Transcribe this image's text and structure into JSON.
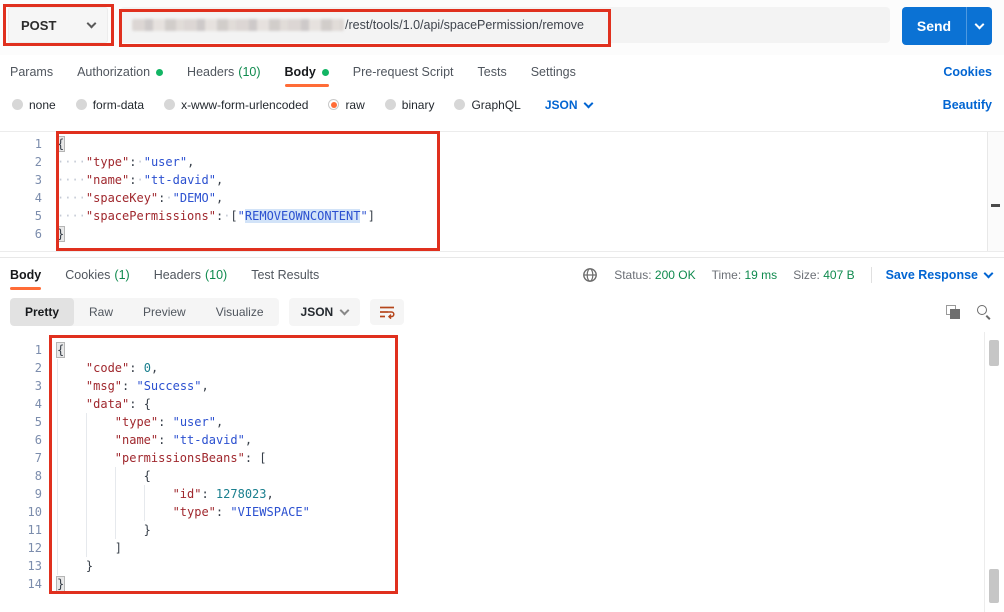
{
  "request": {
    "method": "POST",
    "url_visible": "/rest/tools/1.0/api/spacePermission/remove",
    "send_label": "Send",
    "cookies_link": "Cookies",
    "beautify_link": "Beautify",
    "tabs": [
      {
        "label": "Params"
      },
      {
        "label": "Authorization",
        "dot": true
      },
      {
        "label": "Headers",
        "count": "(10)"
      },
      {
        "label": "Body",
        "dot": true,
        "active": true
      },
      {
        "label": "Pre-request Script"
      },
      {
        "label": "Tests"
      },
      {
        "label": "Settings"
      }
    ],
    "body_modes": [
      {
        "label": "none"
      },
      {
        "label": "form-data"
      },
      {
        "label": "x-www-form-urlencoded"
      },
      {
        "label": "raw",
        "selected": true
      },
      {
        "label": "binary"
      },
      {
        "label": "GraphQL"
      }
    ],
    "language": "JSON",
    "editor_lines": [
      [
        {
          "t": "hl",
          "v": "{"
        }
      ],
      [
        {
          "t": "w",
          "v": "····"
        },
        {
          "t": "k",
          "v": "\"type\""
        },
        {
          "t": "p",
          "v": ":"
        },
        {
          "t": "w",
          "v": "·"
        },
        {
          "t": "s",
          "v": "\"user\""
        },
        {
          "t": "p",
          "v": ","
        }
      ],
      [
        {
          "t": "w",
          "v": "····"
        },
        {
          "t": "k",
          "v": "\"name\""
        },
        {
          "t": "p",
          "v": ":"
        },
        {
          "t": "w",
          "v": "·"
        },
        {
          "t": "s",
          "v": "\"tt-david\""
        },
        {
          "t": "p",
          "v": ","
        }
      ],
      [
        {
          "t": "w",
          "v": "····"
        },
        {
          "t": "k",
          "v": "\"spaceKey\""
        },
        {
          "t": "p",
          "v": ":"
        },
        {
          "t": "w",
          "v": "·"
        },
        {
          "t": "s",
          "v": "\"DEMO\""
        },
        {
          "t": "p",
          "v": ","
        }
      ],
      [
        {
          "t": "w",
          "v": "····"
        },
        {
          "t": "k",
          "v": "\"spacePermissions\""
        },
        {
          "t": "p",
          "v": ":"
        },
        {
          "t": "w",
          "v": "·"
        },
        {
          "t": "p",
          "v": "["
        },
        {
          "t": "s",
          "v": "\""
        },
        {
          "t": "sel",
          "v": "REMOVEOWNCONTENT"
        },
        {
          "t": "s",
          "v": "\""
        },
        {
          "t": "p",
          "v": "]"
        }
      ],
      [
        {
          "t": "hl",
          "v": "}"
        }
      ]
    ]
  },
  "response": {
    "tabs": [
      {
        "label": "Body",
        "active": true
      },
      {
        "label": "Cookies",
        "count": "(1)"
      },
      {
        "label": "Headers",
        "count": "(10)"
      },
      {
        "label": "Test Results"
      }
    ],
    "status_label": "Status:",
    "status_value": "200 OK",
    "time_label": "Time:",
    "time_value": "19 ms",
    "size_label": "Size:",
    "size_value": "407 B",
    "save_response_label": "Save Response",
    "views": [
      {
        "label": "Pretty",
        "active": true
      },
      {
        "label": "Raw"
      },
      {
        "label": "Preview"
      },
      {
        "label": "Visualize"
      }
    ],
    "language": "JSON",
    "editor_lines": [
      [
        {
          "t": "hl",
          "v": "{"
        }
      ],
      [
        {
          "t": "g"
        },
        {
          "t": "k",
          "v": "\"code\""
        },
        {
          "t": "p",
          "v": ": "
        },
        {
          "t": "n",
          "v": "0"
        },
        {
          "t": "p",
          "v": ","
        }
      ],
      [
        {
          "t": "g"
        },
        {
          "t": "k",
          "v": "\"msg\""
        },
        {
          "t": "p",
          "v": ": "
        },
        {
          "t": "s",
          "v": "\"Success\""
        },
        {
          "t": "p",
          "v": ","
        }
      ],
      [
        {
          "t": "g"
        },
        {
          "t": "k",
          "v": "\"data\""
        },
        {
          "t": "p",
          "v": ": {"
        }
      ],
      [
        {
          "t": "g"
        },
        {
          "t": "g"
        },
        {
          "t": "k",
          "v": "\"type\""
        },
        {
          "t": "p",
          "v": ": "
        },
        {
          "t": "s",
          "v": "\"user\""
        },
        {
          "t": "p",
          "v": ","
        }
      ],
      [
        {
          "t": "g"
        },
        {
          "t": "g"
        },
        {
          "t": "k",
          "v": "\"name\""
        },
        {
          "t": "p",
          "v": ": "
        },
        {
          "t": "s",
          "v": "\"tt-david\""
        },
        {
          "t": "p",
          "v": ","
        }
      ],
      [
        {
          "t": "g"
        },
        {
          "t": "g"
        },
        {
          "t": "k",
          "v": "\"permissionsBeans\""
        },
        {
          "t": "p",
          "v": ": ["
        }
      ],
      [
        {
          "t": "g"
        },
        {
          "t": "g"
        },
        {
          "t": "g"
        },
        {
          "t": "p",
          "v": "{"
        }
      ],
      [
        {
          "t": "g"
        },
        {
          "t": "g"
        },
        {
          "t": "g"
        },
        {
          "t": "g"
        },
        {
          "t": "k",
          "v": "\"id\""
        },
        {
          "t": "p",
          "v": ": "
        },
        {
          "t": "n",
          "v": "1278023"
        },
        {
          "t": "p",
          "v": ","
        }
      ],
      [
        {
          "t": "g"
        },
        {
          "t": "g"
        },
        {
          "t": "g"
        },
        {
          "t": "g"
        },
        {
          "t": "k",
          "v": "\"type\""
        },
        {
          "t": "p",
          "v": ": "
        },
        {
          "t": "s",
          "v": "\"VIEWSPACE\""
        }
      ],
      [
        {
          "t": "g"
        },
        {
          "t": "g"
        },
        {
          "t": "g"
        },
        {
          "t": "p",
          "v": "}"
        }
      ],
      [
        {
          "t": "g"
        },
        {
          "t": "g"
        },
        {
          "t": "p",
          "v": "]"
        }
      ],
      [
        {
          "t": "g"
        },
        {
          "t": "p",
          "v": "}"
        }
      ],
      [
        {
          "t": "hl",
          "v": "}"
        }
      ]
    ]
  },
  "colors": {
    "accent_orange": "#ff6c37",
    "link_blue": "#0265d2",
    "send_blue": "#0b72d4",
    "success_green": "#0f8a4e",
    "annotation_red": "#e0301e"
  }
}
